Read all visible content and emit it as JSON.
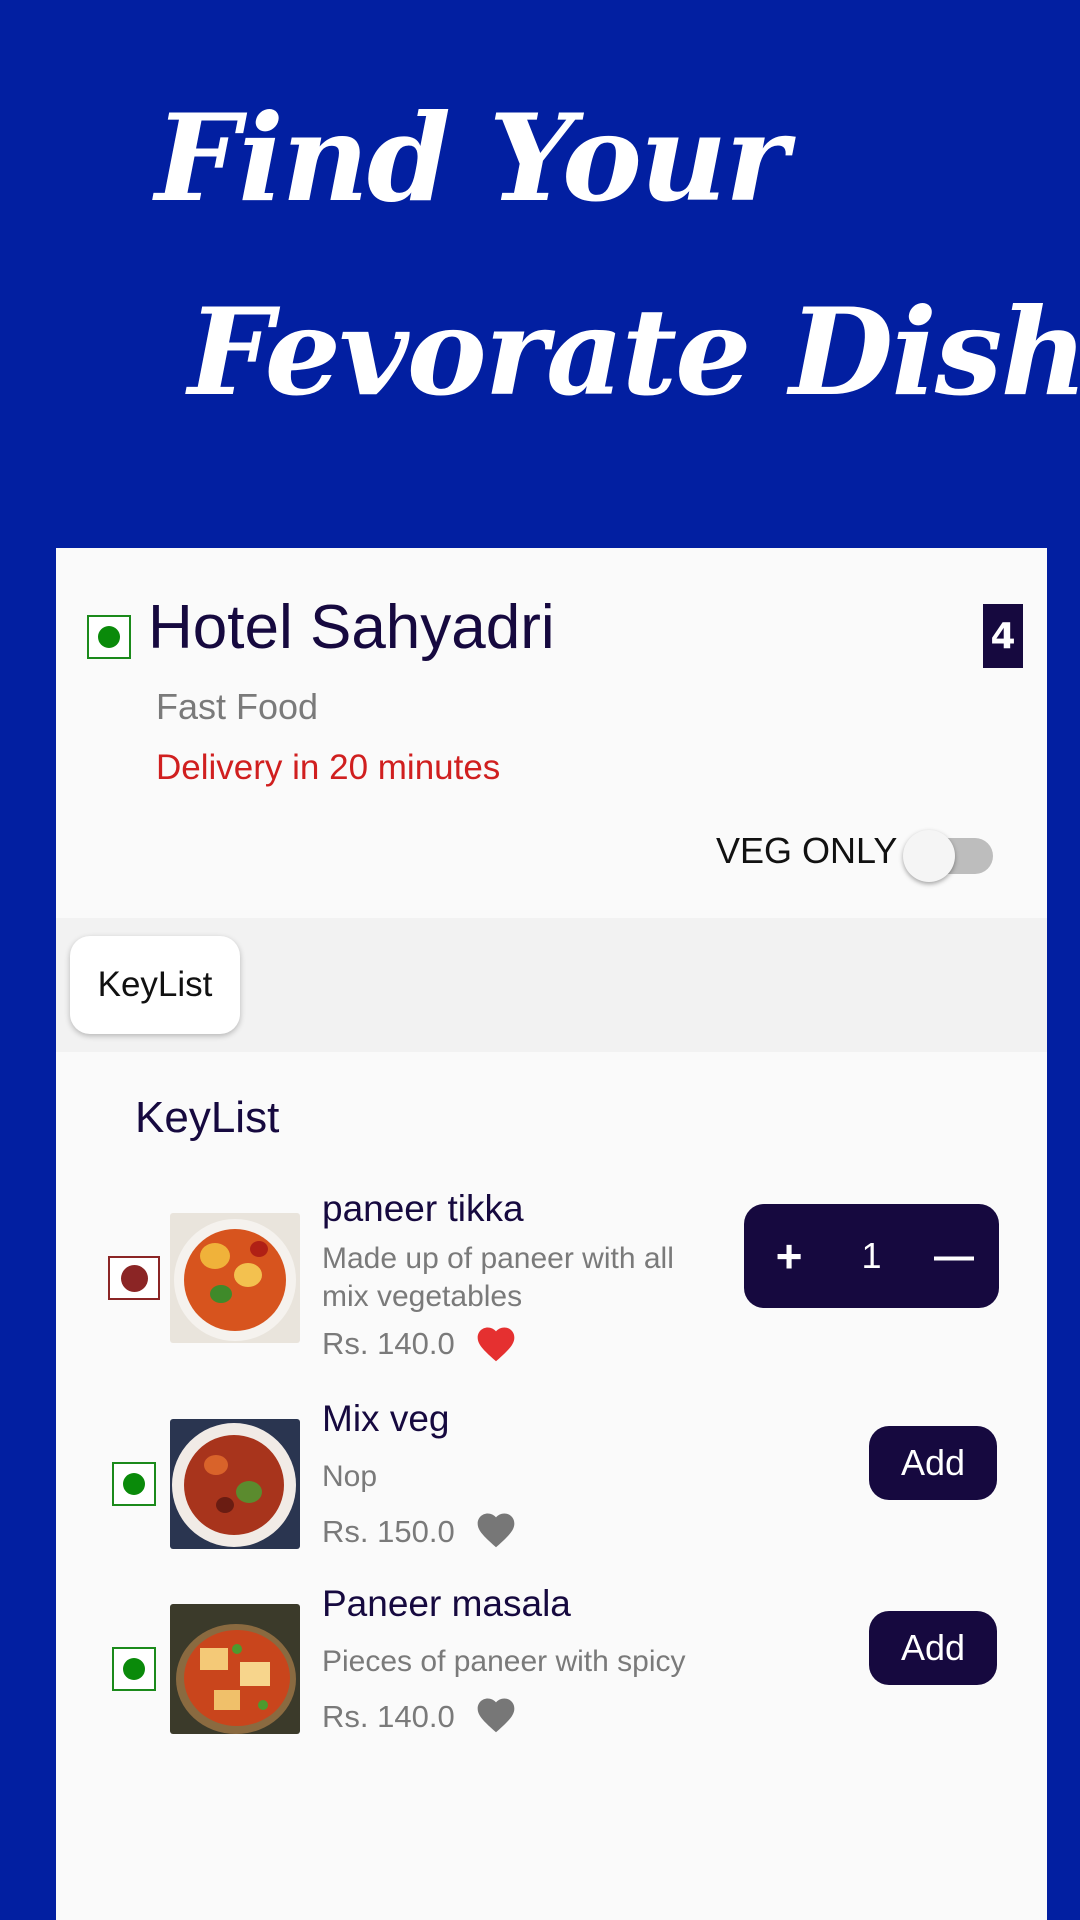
{
  "banner": {
    "line1": "Find Your",
    "line2": "Fevorate Dish"
  },
  "restaurant": {
    "name": "Hotel Sahyadri",
    "category": "Fast Food",
    "delivery": "Delivery in 20 minutes",
    "cart_count": "4",
    "is_veg": true
  },
  "filter": {
    "veg_only_label": "VEG ONLY",
    "veg_only_enabled": false
  },
  "chips": [
    {
      "label": "KeyList",
      "selected": true
    }
  ],
  "section": {
    "title": "KeyList"
  },
  "items": [
    {
      "name": "paneer tikka",
      "description": "Made up of paneer with all mix vegetables",
      "price": "Rs. 140.0",
      "veg": false,
      "favorite": true,
      "quantity": "1",
      "plus": "+",
      "minus": "—"
    },
    {
      "name": "Mix veg",
      "description": "Nop",
      "price": "Rs. 150.0",
      "veg": true,
      "favorite": false,
      "add_label": "Add"
    },
    {
      "name": "Paneer masala",
      "description": "Pieces of paneer with spicy",
      "price": "Rs. 140.0",
      "veg": true,
      "favorite": false,
      "add_label": "Add"
    }
  ],
  "colors": {
    "background": "#021fa1",
    "primary": "#16093f",
    "veg": "#0a8a0a",
    "nonveg": "#8b2525",
    "delivery": "#d01f1f",
    "heart_active": "#e53030",
    "heart_inactive": "#777777"
  }
}
